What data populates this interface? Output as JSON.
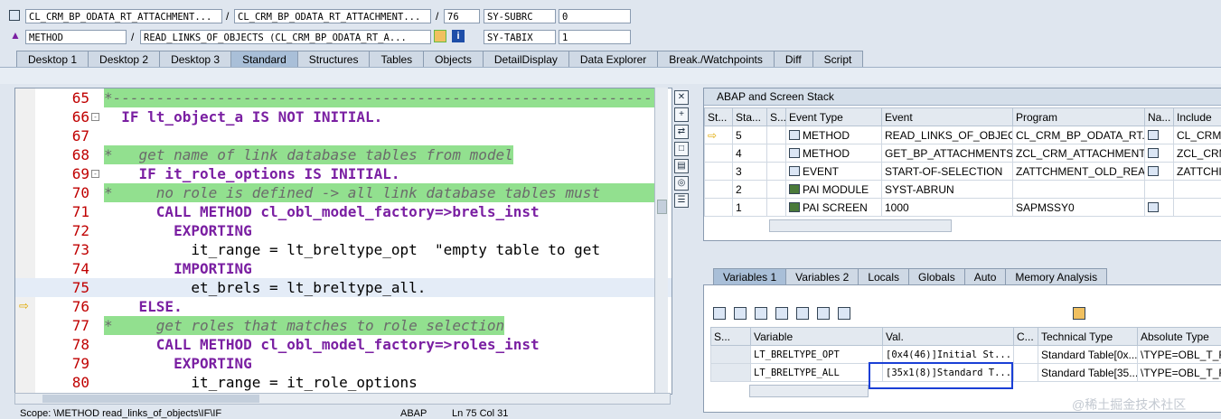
{
  "header": {
    "row1": {
      "field1": "CL_CRM_BP_ODATA_RT_ATTACHMENT...",
      "field2": "CL_CRM_BP_ODATA_RT_ATTACHMENT...",
      "line": "76",
      "sysvar": "SY-SUBRC",
      "sysval": "0"
    },
    "row2": {
      "type": "METHOD",
      "name": "READ_LINKS_OF_OBJECTS (CL_CRM_BP_ODATA_RT_A...",
      "sysvar": "SY-TABIX",
      "sysval": "1"
    },
    "sep": "/"
  },
  "tabs": [
    "Desktop 1",
    "Desktop 2",
    "Desktop 3",
    "Standard",
    "Structures",
    "Tables",
    "Objects",
    "DetailDisplay",
    "Data Explorer",
    "Break./Watchpoints",
    "Diff",
    "Script"
  ],
  "code": [
    {
      "n": "65",
      "text": "*-------------------------------------------------------------------"
    },
    {
      "n": "66",
      "text": "  IF lt_object_a IS NOT INITIAL."
    },
    {
      "n": "67",
      "text": ""
    },
    {
      "n": "68",
      "text": "*   get name of link database tables from model"
    },
    {
      "n": "69",
      "text": "    IF it_role_options IS INITIAL."
    },
    {
      "n": "70",
      "text": "*     no role is defined -> all link database tables must"
    },
    {
      "n": "71",
      "text": "      CALL METHOD cl_obl_model_factory=>brels_inst"
    },
    {
      "n": "72",
      "text": "        EXPORTING"
    },
    {
      "n": "73",
      "text": "          it_range = lt_breltype_opt  \"empty table to get"
    },
    {
      "n": "74",
      "text": "        IMPORTING"
    },
    {
      "n": "75",
      "text": "          et_brels = lt_breltype_all."
    },
    {
      "n": "76",
      "text": "    ELSE."
    },
    {
      "n": "77",
      "text": "*     get roles that matches to role selection"
    },
    {
      "n": "78",
      "text": "      CALL METHOD cl_obl_model_factory=>roles_inst"
    },
    {
      "n": "79",
      "text": "        EXPORTING"
    },
    {
      "n": "80",
      "text": "          it_range = it_role_options"
    }
  ],
  "stack": {
    "title": "ABAP and Screen Stack",
    "columns": [
      "St...",
      "Sta...",
      "S...",
      "Event Type",
      "Event",
      "Program",
      "Na...",
      "Include"
    ],
    "rows": [
      {
        "level": "5",
        "type": "METHOD",
        "event": "READ_LINKS_OF_OBJEC...",
        "program": "CL_CRM_BP_ODATA_RT...",
        "include": "CL_CRM_"
      },
      {
        "level": "4",
        "type": "METHOD",
        "event": "GET_BP_ATTACHMENTS",
        "program": "ZCL_CRM_ATTACHMENT...",
        "include": "ZCL_CRM"
      },
      {
        "level": "3",
        "type": "EVENT",
        "event": "START-OF-SELECTION",
        "program": "ZATTCHMENT_OLD_REA...",
        "include": "ZATTCHI"
      },
      {
        "level": "2",
        "type": "PAI MODULE",
        "event": "SYST-ABRUN",
        "program": "",
        "include": ""
      },
      {
        "level": "1",
        "type": "PAI SCREEN",
        "event": "1000",
        "program": "SAPMSSY0",
        "include": ""
      }
    ]
  },
  "vartabs": [
    "Variables 1",
    "Variables 2",
    "Locals",
    "Globals",
    "Auto",
    "Memory Analysis"
  ],
  "vars": {
    "columns": [
      "S...",
      "Variable",
      "Val.",
      "C...",
      "Technical Type",
      "Absolute Type"
    ],
    "rows": [
      {
        "name": "LT_BRELTYPE_OPT",
        "val": "[0x4(46)]Initial St...",
        "tech": "Standard Table[0x...",
        "abs": "\\TYPE=OBL_T_R"
      },
      {
        "name": "LT_BRELTYPE_ALL",
        "val": "[35x1(8)]Standard T...",
        "tech": "Standard Table[35...",
        "abs": "\\TYPE=OBL_T_R"
      }
    ]
  },
  "status": {
    "scope": "Scope: \\METHOD read_links_of_objects\\IF\\IF",
    "lang": "ABAP",
    "pos": "Ln 75 Col 31"
  },
  "watermark": "@稀土掘金技术社区"
}
